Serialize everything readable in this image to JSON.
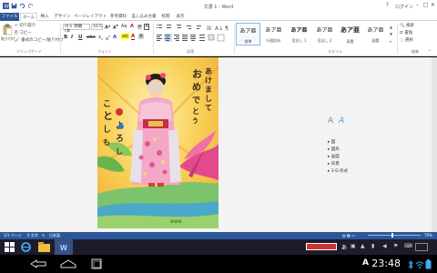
{
  "window": {
    "title": "文書 1 - Word",
    "user": "ログイン",
    "help": "?"
  },
  "tabs": [
    "ファイル",
    "ホーム",
    "挿入",
    "デザイン",
    "ページレイアウト",
    "参考資料",
    "差し込み文書",
    "校閲",
    "表示"
  ],
  "clipboard": {
    "paste": "貼り付け",
    "cut": "切り取り",
    "copy": "コピー",
    "format_painter": "書式のコピー/貼り付け",
    "group_label": "クリップボード"
  },
  "font": {
    "name": "ＭＳ 明朝 (本",
    "size": "10.5",
    "group_label": "フォント"
  },
  "paragraph": {
    "group_label": "段落"
  },
  "styles": {
    "items": [
      {
        "sample": "あア亜",
        "name": "標準"
      },
      {
        "sample": "あア亜",
        "name": "行間詰め"
      },
      {
        "sample": "あア亜",
        "name": "見出し 1"
      },
      {
        "sample": "あア亜",
        "name": "見出し 2"
      },
      {
        "sample": "あア亜",
        "name": "表題"
      },
      {
        "sample": "あア亜",
        "name": "副題"
      }
    ],
    "group_label": "スタイル"
  },
  "editing": {
    "find": "検索",
    "replace": "置換",
    "select": "選択",
    "group_label": "編集"
  },
  "nav_pane": {
    "items": [
      "図",
      "図形",
      "画面",
      "背景",
      "3-D 形式"
    ]
  },
  "status": {
    "page": "1/1 ページ",
    "words": "0 文字",
    "lang": "日本語",
    "zoom": "70%"
  },
  "taskbar": {
    "ime": "あ"
  },
  "android": {
    "time": "23:48",
    "a_icon": "A"
  },
  "colors": {
    "accent": "#2b579a",
    "page_bg": "#f5c54a"
  }
}
